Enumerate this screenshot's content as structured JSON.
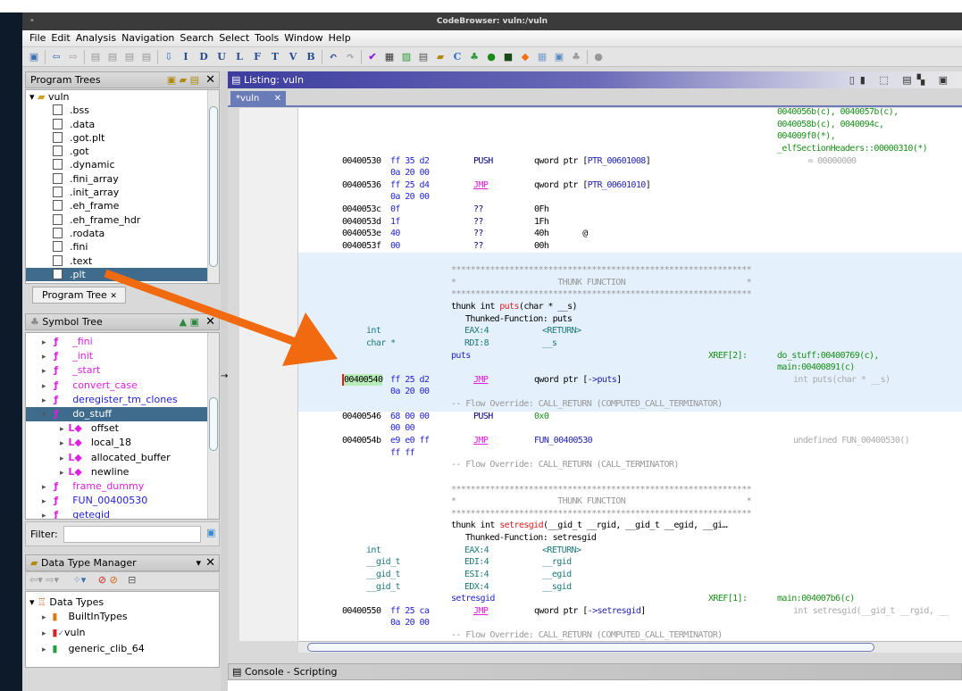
{
  "window": {
    "title": "CodeBrowser: vuln:/vuln"
  },
  "menu": [
    "File",
    "Edit",
    "Analysis",
    "Navigation",
    "Search",
    "Select",
    "Tools",
    "Window",
    "Help"
  ],
  "toolbar": {
    "letters": [
      "I",
      "D",
      "U",
      "L",
      "F",
      "T",
      "V",
      "B"
    ]
  },
  "program_trees": {
    "title": "Program Trees",
    "root": "vuln",
    "items": [
      ".bss",
      ".data",
      ".got.plt",
      ".got",
      ".dynamic",
      ".fini_array",
      ".init_array",
      ".eh_frame",
      ".eh_frame_hdr",
      ".rodata",
      ".fini",
      ".text",
      ".plt"
    ],
    "selected": ".plt",
    "tab": "Program Tree"
  },
  "symbol_tree": {
    "title": "Symbol Tree",
    "items": [
      {
        "label": "_fini",
        "color": "#e020e0",
        "level": 0,
        "icon": "function-icon"
      },
      {
        "label": "_init",
        "color": "#e020e0",
        "level": 0,
        "icon": "function-icon"
      },
      {
        "label": "_start",
        "color": "#e020e0",
        "level": 0,
        "icon": "function-icon"
      },
      {
        "label": "convert_case",
        "color": "#e020e0",
        "level": 0,
        "icon": "function-icon"
      },
      {
        "label": "deregister_tm_clones",
        "color": "#2323d6",
        "level": 0,
        "icon": "function-icon"
      },
      {
        "label": "do_stuff",
        "color": "#fff",
        "level": 0,
        "icon": "function-icon",
        "selected": true,
        "expanded": true
      },
      {
        "label": "offset",
        "color": "#000",
        "level": 1,
        "icon": "local-variable-icon"
      },
      {
        "label": "local_18",
        "color": "#000",
        "level": 1,
        "icon": "local-variable-icon"
      },
      {
        "label": "allocated_buffer",
        "color": "#000",
        "level": 1,
        "icon": "local-variable-icon"
      },
      {
        "label": "newline",
        "color": "#000",
        "level": 1,
        "icon": "local-variable-icon"
      },
      {
        "label": "frame_dummy",
        "color": "#e020e0",
        "level": 0,
        "icon": "function-icon"
      },
      {
        "label": "FUN_00400530",
        "color": "#2323d6",
        "level": 0,
        "icon": "function-icon"
      },
      {
        "label": "getegid",
        "color": "#2323d6",
        "level": 0,
        "icon": "external-function-icon"
      }
    ],
    "filter_label": "Filter:",
    "filter_value": ""
  },
  "data_types": {
    "title": "Data Type Manager",
    "root": "Data Types",
    "items": [
      {
        "label": "BuiltInTypes",
        "color": "#e07a10"
      },
      {
        "label": "vuln",
        "color": "#e02020"
      },
      {
        "label": "generic_clib_64",
        "color": "#20a040"
      }
    ]
  },
  "listing": {
    "title": "Listing:  vuln",
    "tab": "*vuln",
    "lines": [
      {
        "xref": "0040056b(c), 0040057b(c),"
      },
      {
        "xref": "0040058b(c), 0040094c,"
      },
      {
        "xref": "004009f0(*),"
      },
      {
        "xref": "_elfSectionHeaders::00000310(*)"
      },
      {
        "addr": "00400530",
        "bytes": "ff 35 d2",
        "mnem": "PUSH",
        "op_pre": "qword ptr [",
        "op_lbl": "PTR_00601008",
        "op_post": "]",
        "cmt": "   = 00000000"
      },
      {
        "bytes": "0a 20 00"
      },
      {
        "addr": "00400536",
        "bytes": "ff 25 d4",
        "mnem": "JMP",
        "op_pre": "qword ptr [",
        "op_lbl": "PTR_00601010",
        "op_post": "]"
      },
      {
        "bytes": "0a 20 00"
      },
      {
        "addr": "0040053c",
        "bytes": "0f",
        "mnem": "??",
        "op_pre": "0Fh"
      },
      {
        "addr": "0040053d",
        "bytes": "1f",
        "mnem": "??",
        "op_pre": "1Fh"
      },
      {
        "addr": "0040053e",
        "bytes": "40",
        "mnem": "??",
        "op_pre": "40h       @"
      },
      {
        "addr": "0040053f",
        "bytes": "00",
        "mnem": "??",
        "op_pre": "00h"
      },
      {},
      {
        "text": "**************************************************************"
      },
      {
        "text": "*                     THUNK FUNCTION                         *"
      },
      {
        "text": "**************************************************************"
      },
      {
        "sig_pre": "thunk int ",
        "sig_fn": "puts",
        "sig_post": "(char * __s)"
      },
      {
        "thunked": "Thunked-Function: puts"
      },
      {
        "type": "int",
        "stor": "EAX:4",
        "pname": "<RETURN>"
      },
      {
        "type": "char *",
        "stor": "RDI:8",
        "pname": "__s"
      },
      {
        "label": "puts",
        "xlab": "XREF[2]:",
        "xref": "do_stuff:00400769(c),"
      },
      {
        "xref": "main:00400891(c)"
      },
      {
        "addr": "00400540",
        "bytes": "ff 25 d2",
        "mnem": "JMP",
        "op_pre": "qword ptr [",
        "op_lbl": "->puts",
        "op_post": "]",
        "cmt": "int puts(char * __s)",
        "selected": true
      },
      {
        "bytes": "0a 20 00"
      },
      {
        "text": "-- Flow Override: CALL_RETURN (COMPUTED_CALL_TERMINATOR)"
      },
      {
        "addr": "00400546",
        "bytes": "68 00 00",
        "mnem": "PUSH",
        "op_num": "0x0"
      },
      {
        "bytes": "00 00"
      },
      {
        "addr": "0040054b",
        "bytes": "e9 e0 ff",
        "mnem": "JMP",
        "op_lbl": "FUN_00400530",
        "cmt": "undefined FUN_00400530()"
      },
      {
        "bytes": "ff ff"
      },
      {
        "text": "-- Flow Override: CALL_RETURN (CALL_TERMINATOR)"
      },
      {},
      {
        "text": "**************************************************************"
      },
      {
        "text": "*                     THUNK FUNCTION                         *"
      },
      {
        "text": "**************************************************************"
      },
      {
        "sig_pre": "thunk int ",
        "sig_fn": "setresgid",
        "sig_post": "(__gid_t __rgid, __gid_t __egid, __gi…"
      },
      {
        "thunked": "Thunked-Function: setresgid"
      },
      {
        "type": "int",
        "stor": "EAX:4",
        "pname": "<RETURN>"
      },
      {
        "type": "__gid_t",
        "stor": "EDI:4",
        "pname": "__rgid"
      },
      {
        "type": "__gid_t",
        "stor": "ESI:4",
        "pname": "__egid"
      },
      {
        "type": "__gid_t",
        "stor": "EDX:4",
        "pname": "__sgid"
      },
      {
        "label": "setresgid",
        "xlab": "XREF[1]:",
        "xref": "main:004007b6(c)"
      },
      {
        "addr": "00400550",
        "bytes": "ff 25 ca",
        "mnem": "JMP",
        "op_pre": "qword ptr [",
        "op_lbl": "->setresgid",
        "op_post": "]",
        "cmt": "int setresgid(__gid_t __rgid, __"
      },
      {
        "bytes": "0a 20 00"
      },
      {
        "text": "-- Flow Override: CALL_RETURN (COMPUTED_CALL_TERMINATOR)"
      }
    ]
  },
  "console": {
    "title": "Console - Scripting"
  },
  "colors": {
    "annotation_arrow": "#f26a10",
    "selection_bg": "#3f6b8c",
    "thunk_highlight": "#e4f0fb",
    "listing_header": "#3c3c9e"
  }
}
